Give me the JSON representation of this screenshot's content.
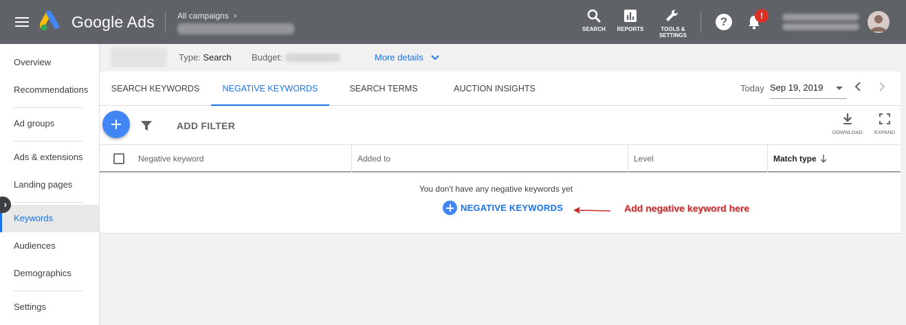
{
  "app": {
    "name": "Google Ads",
    "breadcrumb": "All campaigns",
    "accent": "#1a73e8",
    "topbar_color": "#5f6368"
  },
  "toolbar_top": {
    "search": "SEARCH",
    "reports": "REPORTS",
    "tools": "TOOLS & SETTINGS",
    "notification_badge": "!"
  },
  "sidebar": {
    "items": [
      {
        "label": "Overview"
      },
      {
        "label": "Recommendations"
      },
      {
        "label": "Ad groups"
      },
      {
        "label": "Ads & extensions"
      },
      {
        "label": "Landing pages"
      },
      {
        "label": "Keywords"
      },
      {
        "label": "Audiences"
      },
      {
        "label": "Demographics"
      },
      {
        "label": "Settings"
      }
    ],
    "active": "Keywords"
  },
  "campaign_info": {
    "type_label": "Type:",
    "type_value": "Search",
    "budget_label": "Budget:",
    "more_details": "More details"
  },
  "tabs": [
    {
      "label": "SEARCH KEYWORDS"
    },
    {
      "label": "NEGATIVE KEYWORDS"
    },
    {
      "label": "SEARCH TERMS"
    },
    {
      "label": "AUCTION INSIGHTS"
    }
  ],
  "active_tab": "NEGATIVE KEYWORDS",
  "date": {
    "today_label": "Today",
    "value": "Sep 19, 2019"
  },
  "table_toolbar": {
    "add_filter": "ADD FILTER",
    "download": "DOWNLOAD",
    "expand": "EXPAND"
  },
  "table": {
    "columns": [
      "Negative keyword",
      "Added to",
      "Level",
      "Match type"
    ],
    "empty_message": "You don't have any negative keywords yet",
    "add_button": "NEGATIVE KEYWORDS"
  },
  "annotation": {
    "text": "Add negative keyword here",
    "color": "#d32f2f"
  },
  "icons": {
    "menu": "hamburger-icon",
    "search": "magnifier-icon",
    "reports": "bar-chart-icon",
    "tools": "wrench-icon",
    "help": "help-icon",
    "notifications": "bell-icon",
    "filter": "funnel-icon",
    "download": "download-icon",
    "expand": "expand-icon"
  }
}
